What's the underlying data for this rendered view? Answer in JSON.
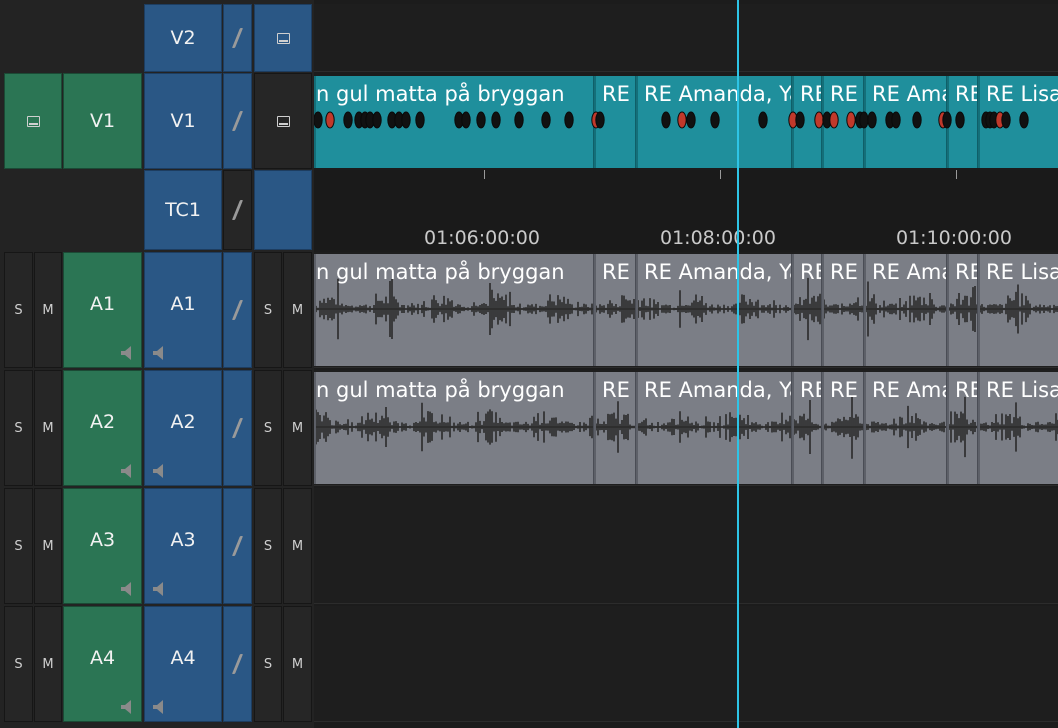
{
  "tracks": {
    "v2": {
      "dest": "V2"
    },
    "v1": {
      "source": "V1",
      "dest": "V1"
    },
    "tc1": {
      "dest": "TC1"
    },
    "audio": [
      {
        "source": "A1",
        "dest": "A1",
        "solo": "S",
        "mute": "M"
      },
      {
        "source": "A2",
        "dest": "A2",
        "solo": "S",
        "mute": "M"
      },
      {
        "source": "A3",
        "dest": "A3",
        "solo": "S",
        "mute": "M"
      },
      {
        "source": "A4",
        "dest": "A4",
        "solo": "S",
        "mute": "M"
      }
    ]
  },
  "timecodes": [
    "01:06:00:00",
    "01:08:00:00",
    "01:10:00:00"
  ],
  "clips": [
    {
      "name": "n gul matta på bryggan"
    },
    {
      "name": "RE Vi"
    },
    {
      "name": "RE Amanda, Ya"
    },
    {
      "name": "RE"
    },
    {
      "name": "RE T"
    },
    {
      "name": "RE Amanda"
    },
    {
      "name": "RE"
    },
    {
      "name": "RE Lisa"
    }
  ],
  "colors": {
    "source_track": "#2b7554",
    "record_track": "#2a5785",
    "video_clip": "#1f8f9c",
    "audio_clip": "#7b7e86",
    "playhead": "#2ec4e6",
    "marker_red": "#c0392b",
    "marker_black": "#111111"
  },
  "icons": {
    "monitor": "monitor-icon",
    "speaker": "speaker-icon",
    "lock": "lock-icon"
  }
}
